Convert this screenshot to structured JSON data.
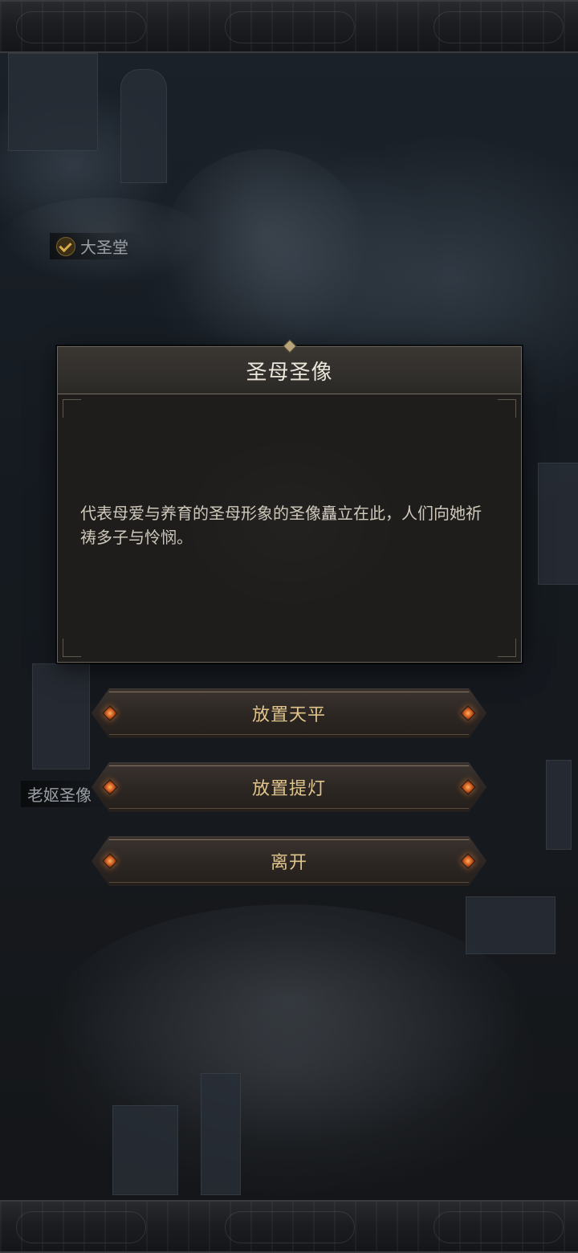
{
  "map": {
    "labels": [
      {
        "text": "大圣堂",
        "checked": true
      },
      {
        "text": "老妪圣像",
        "checked": false
      }
    ]
  },
  "dialog": {
    "title": "圣母圣像",
    "text": "代表母爱与养育的圣母形象的圣像矗立在此，人们向她祈祷多子与怜悯。"
  },
  "options": [
    {
      "label": "放置天平"
    },
    {
      "label": "放置提灯"
    },
    {
      "label": "离开"
    }
  ],
  "colors": {
    "accent_gold": "#e0c48c",
    "gem_orange": "#c8541c",
    "panel_bg": "#1e1d1c"
  }
}
